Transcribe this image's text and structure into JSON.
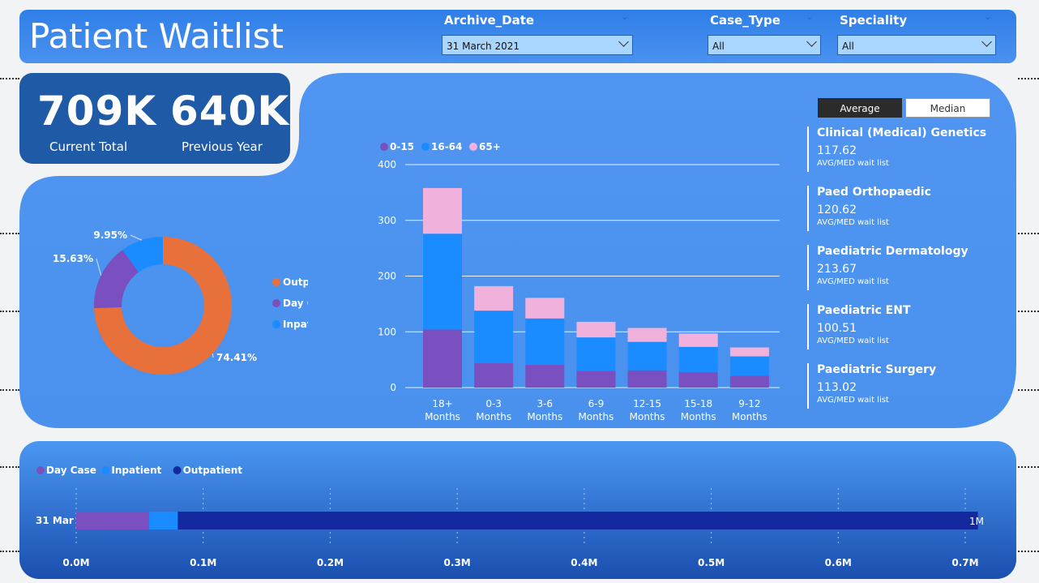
{
  "header": {
    "title": "Patient Waitlist",
    "filters": [
      {
        "label": "Archive_Date",
        "value": "31 March 2021"
      },
      {
        "label": "Case_Type",
        "value": "All"
      },
      {
        "label": "Speciality",
        "value": "All"
      }
    ]
  },
  "kpi": {
    "current_value": "709K",
    "current_label": "Current Total",
    "previous_value": "640K",
    "previous_label": "Previous Year"
  },
  "toggle": {
    "average": "Average",
    "median": "Median"
  },
  "specialities": [
    {
      "name": "Clinical (Medical) Genetics",
      "value": "117.62",
      "sub": "AVG/MED wait list"
    },
    {
      "name": "Paed Orthopaedic",
      "value": "120.62",
      "sub": "AVG/MED wait list"
    },
    {
      "name": "Paediatric Dermatology",
      "value": "213.67",
      "sub": "AVG/MED wait list"
    },
    {
      "name": "Paediatric ENT",
      "value": "100.51",
      "sub": "AVG/MED wait list"
    },
    {
      "name": "Paediatric Surgery",
      "value": "113.02",
      "sub": "AVG/MED wait list"
    }
  ],
  "colors": {
    "outpatient": "#e8703a",
    "daycase": "#7a4fc0",
    "inpatient": "#1a8cff",
    "age_0_15": "#7a4fc0",
    "age_16_64": "#1a8cff",
    "age_65": "#f0b2dd",
    "bottom_outpatient": "#1428a0"
  },
  "chart_data": [
    {
      "type": "pie",
      "labels": [
        "Outpatient",
        "Day Case",
        "Inpatient"
      ],
      "values": [
        74.41,
        15.63,
        9.95
      ],
      "data_labels": [
        "74.41%",
        "15.63%",
        "9.95%"
      ]
    },
    {
      "type": "bar",
      "stacked": true,
      "categories": [
        [
          "18+",
          "Months"
        ],
        [
          "0-3",
          "Months"
        ],
        [
          "3-6",
          "Months"
        ],
        [
          "6-9",
          "Months"
        ],
        [
          "12-15",
          "Months"
        ],
        [
          "15-18",
          "Months"
        ],
        [
          "9-12",
          "Months"
        ]
      ],
      "series": [
        {
          "name": "0-15",
          "values": [
            104,
            44,
            41,
            30,
            31,
            28,
            21
          ]
        },
        {
          "name": "16-64",
          "values": [
            172,
            94,
            83,
            60,
            51,
            45,
            35
          ]
        },
        {
          "name": "65+",
          "values": [
            82,
            44,
            37,
            28,
            25,
            24,
            16
          ]
        }
      ],
      "ylim": [
        0,
        400
      ],
      "yticks": [
        "0",
        "100",
        "200",
        "300",
        "400"
      ],
      "grid": true,
      "legend": "top-left"
    },
    {
      "type": "bar",
      "orientation": "horizontal",
      "stacked": true,
      "categories": [
        "31 Mar"
      ],
      "series": [
        {
          "name": "Day Case",
          "values": [
            0.0575
          ]
        },
        {
          "name": "Inpatient",
          "values": [
            0.0225
          ]
        },
        {
          "name": "Outpatient",
          "values": [
            0.63
          ]
        }
      ],
      "xlim": [
        0,
        0.7
      ],
      "xticks": [
        "0.0M",
        "0.1M",
        "0.2M",
        "0.3M",
        "0.4M",
        "0.5M",
        "0.6M",
        "0.7M"
      ],
      "end_label": "1M",
      "legend": "top-left"
    }
  ]
}
